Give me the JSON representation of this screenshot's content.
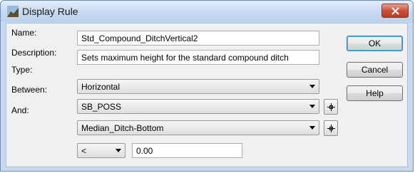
{
  "window": {
    "title": "Display Rule"
  },
  "form": {
    "name": {
      "label": "Name:",
      "value": "Std_Compound_DitchVertical2"
    },
    "description": {
      "label": "Description:",
      "value": "Sets maximum height for the standard compound ditch"
    },
    "type": {
      "label": "Type:",
      "value": "Horizontal"
    },
    "between": {
      "label": "Between:",
      "value": "SB_POSS"
    },
    "and": {
      "label": "And:",
      "value": "Median_Ditch-Bottom"
    },
    "operator": {
      "value": "<"
    },
    "threshold": {
      "value": "0.00"
    }
  },
  "buttons": {
    "ok": "OK",
    "cancel": "Cancel",
    "help": "Help"
  },
  "icons": {
    "title": "road-profile-icon",
    "close": "close-icon",
    "dropdown": "chevron-down-icon",
    "pick": "crosshair-pick-icon"
  }
}
